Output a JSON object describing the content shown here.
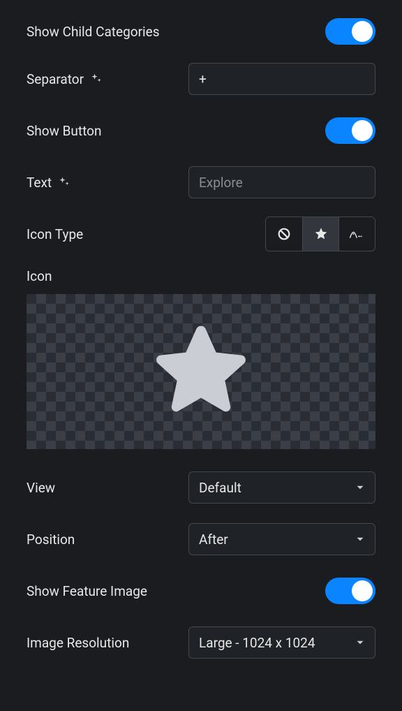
{
  "rows": {
    "showChild": {
      "label": "Show Child Categories",
      "value": true
    },
    "separator": {
      "label": "Separator",
      "value": "+",
      "hasSparkle": true
    },
    "showButton": {
      "label": "Show Button",
      "value": true
    },
    "text": {
      "label": "Text",
      "placeholder": "Explore",
      "value": "",
      "hasSparkle": true
    },
    "iconType": {
      "label": "Icon Type",
      "options": [
        "none",
        "icon",
        "lottie"
      ],
      "selected": "icon"
    },
    "icon": {
      "label": "Icon",
      "selectedIcon": "star"
    },
    "view": {
      "label": "View",
      "value": "Default"
    },
    "position": {
      "label": "Position",
      "value": "After"
    },
    "showFeatureImage": {
      "label": "Show Feature Image",
      "value": true
    },
    "imageResolution": {
      "label": "Image Resolution",
      "value": "Large - 1024 x 1024"
    }
  }
}
